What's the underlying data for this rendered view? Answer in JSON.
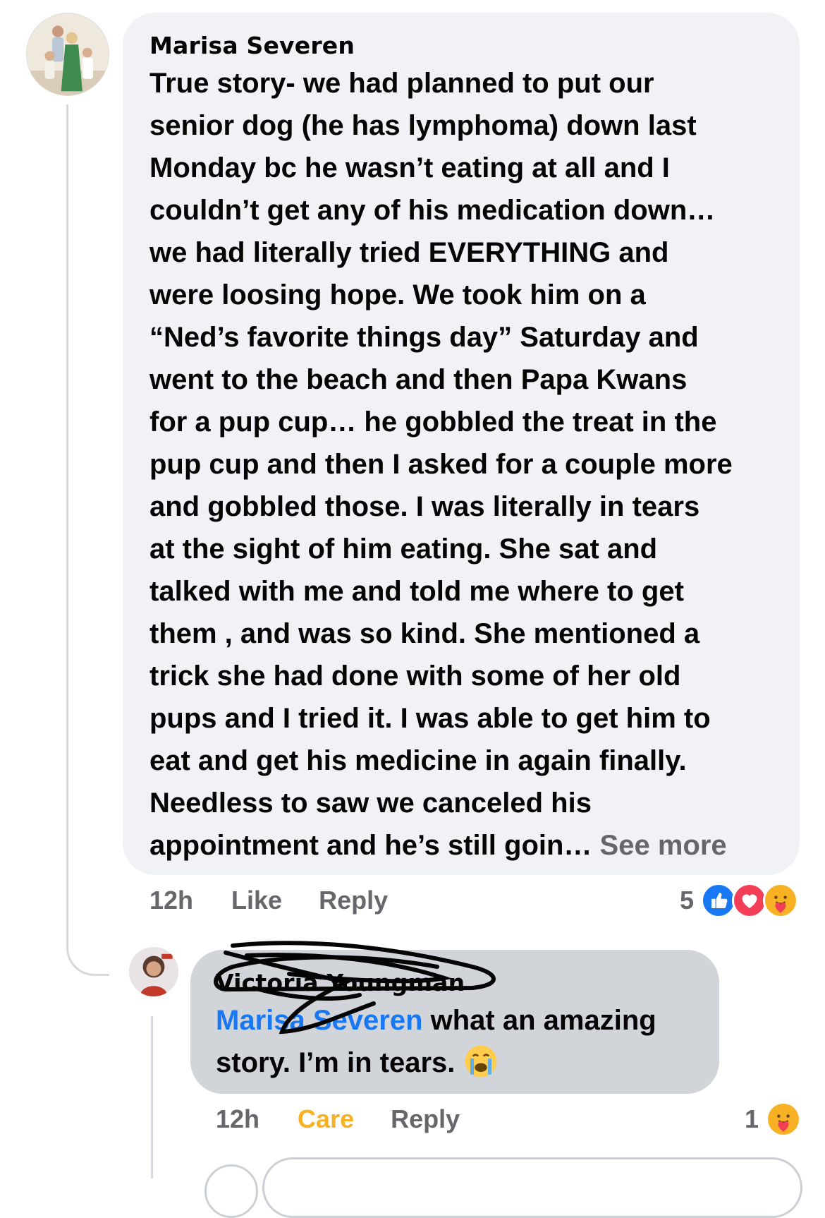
{
  "main_comment": {
    "author": "Marisa Severen",
    "text": "True story- we had planned to put our\nsenior dog (he has lymphoma) down last\nMonday bc he wasn’t eating at all and I\ncouldn’t get any of his medication down…\nwe had literally tried EVERYTHING and\nwere loosing hope. We took him on a\n“Ned’s favorite things day” Saturday and\nwent to the beach and then Papa Kwans\nfor a pup cup… he gobbled the treat in the\npup cup and then I asked for a couple more\nand gobbled those. I was literally in tears\nat the sight of him eating. She sat and\ntalked with me and told me where to get\nthem , and was so kind. She mentioned a\ntrick she had done with some of her old\npups and I tried it. I was able to get him to\neat and get his medicine in again finally.\nNeedless to saw we canceled his\nappointment and he’s still goin…",
    "see_more": "See more",
    "time": "12h",
    "like_label": "Like",
    "reply_label": "Reply",
    "reaction_count": "5",
    "reactions": [
      "like-icon",
      "love-icon",
      "care-icon"
    ]
  },
  "reply_comment": {
    "author": "Victoria Youngman",
    "mention": "Marisa Severen",
    "text_line1": " what an amazing",
    "text_line2": "story. I’m in tears. ",
    "emoji": "crying-face-icon",
    "time": "12h",
    "reaction_label": "Care",
    "reply_label": "Reply",
    "reaction_count": "1",
    "reactions": [
      "care-icon"
    ]
  },
  "colors": {
    "bubble": "#f0f2f5",
    "reply_bubble": "#d1d4d9",
    "meta_text": "#65676b",
    "mention": "#1877f2",
    "care": "#f7b125",
    "like": "#1877f2",
    "love": "#f33e58"
  }
}
